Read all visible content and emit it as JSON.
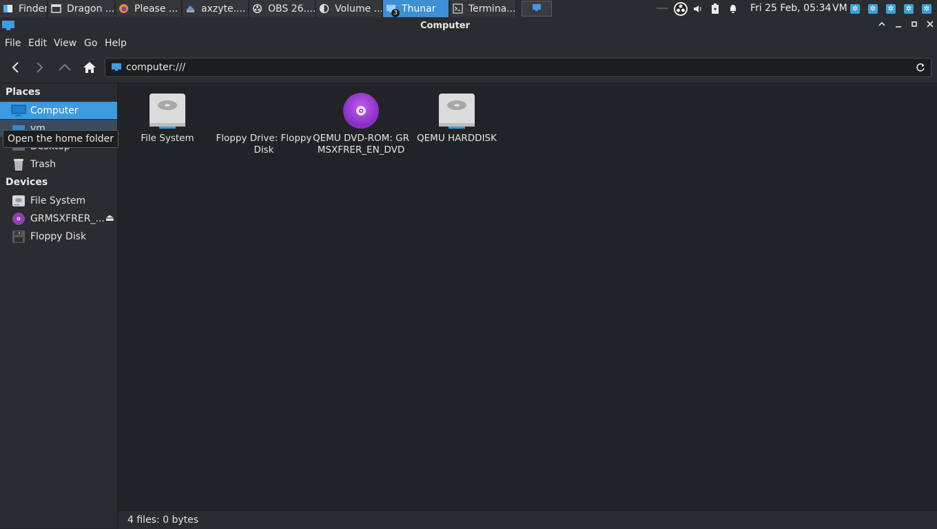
{
  "taskbar": {
    "items": [
      {
        "label": "Finder",
        "icon": "finder-icon"
      },
      {
        "label": "Dragon ...",
        "icon": "window-icon"
      },
      {
        "label": "Please ...",
        "icon": "firefox-icon"
      },
      {
        "label": "axzyte....",
        "icon": "app-icon"
      },
      {
        "label": "OBS 26....",
        "icon": "obs-icon"
      },
      {
        "label": "Volume ...",
        "icon": "volume-app-icon"
      },
      {
        "label": "Thunar",
        "icon": "thunar-icon",
        "badge": "3"
      },
      {
        "label": "Termina...",
        "icon": "terminal-icon"
      }
    ],
    "clock": "Fri 25 Feb, 05:34",
    "user": "VM"
  },
  "window": {
    "title": "Computer"
  },
  "menu": [
    "File",
    "Edit",
    "View",
    "Go",
    "Help"
  ],
  "location": {
    "path": "computer:///"
  },
  "sidebar": {
    "places_heading": "Places",
    "places": [
      {
        "label": "Computer"
      },
      {
        "label": "vm"
      },
      {
        "label": "Desktop"
      },
      {
        "label": "Trash"
      }
    ],
    "devices_heading": "Devices",
    "devices": [
      {
        "label": "File System"
      },
      {
        "label": "GRMSXFRER_..."
      },
      {
        "label": "Floppy Disk"
      }
    ],
    "tooltip": "Open the home folder"
  },
  "files": [
    {
      "name": "File System",
      "icon": "harddisk-icon"
    },
    {
      "name": "Floppy Drive: Floppy Disk",
      "icon": "floppy-icon"
    },
    {
      "name": "QEMU DVD-ROM: GRMSXFRER_EN_DVD",
      "icon": "dvd-icon"
    },
    {
      "name": "QEMU HARDDISK",
      "icon": "harddisk-icon"
    }
  ],
  "status": "4 files: 0 bytes",
  "colors": {
    "accent": "#3d9be0",
    "background": "#222326",
    "panel": "#2b2c2f"
  }
}
